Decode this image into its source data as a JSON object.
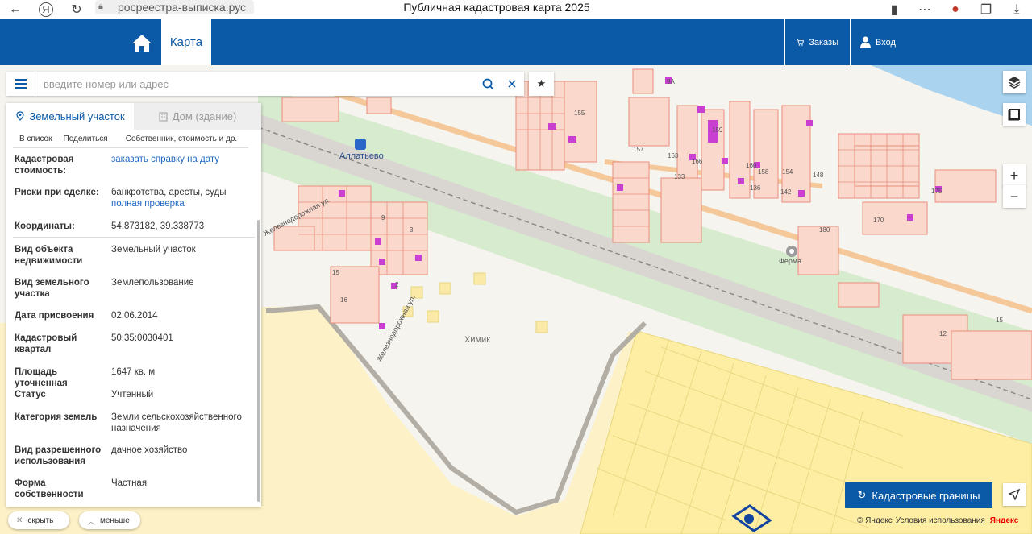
{
  "browser": {
    "url": "росреестра-выписка.рус",
    "title": "Публичная кадастровая карта 2025"
  },
  "header": {
    "tab_map": "Карта",
    "orders": "Заказы",
    "login": "Вход"
  },
  "search": {
    "placeholder": "введите номер или адрес"
  },
  "panel": {
    "tabs": [
      {
        "label": "Земельный участок"
      },
      {
        "label": "Дом (здание)"
      }
    ],
    "actions": {
      "to_list": "В список",
      "share": "Поделиться",
      "owner": "Собственник, стоимость и др."
    },
    "rows": [
      {
        "label": "Кадастровая стоимость:",
        "value": "заказать справку на дату"
      },
      {
        "label": "Риски при сделке:",
        "value": "банкротства, аресты, суды",
        "link": "полная проверка"
      },
      {
        "label": "Координаты:",
        "value": "54.873182, 39.338773"
      },
      {
        "label": "Вид объекта недвижимости",
        "value": "Земельный участок"
      },
      {
        "label": "Вид земельного участка",
        "value": "Землепользование"
      },
      {
        "label": "Дата присвоения",
        "value": "02.06.2014"
      },
      {
        "label": "Кадастровый квартал",
        "value": "50:35:0030401"
      },
      {
        "label": "Площадь уточненная",
        "value": "1647 кв. м"
      },
      {
        "label": "Статус",
        "value": "Учтенный"
      },
      {
        "label": "Категория земель",
        "value": "Земли сельскохозяйственного назначения"
      },
      {
        "label": "Вид разрешенного использования",
        "value": "дачное хозяйство"
      },
      {
        "label": "Форма собственности",
        "value": "Частная"
      }
    ]
  },
  "bottom": {
    "hide": "скрыть",
    "less": "меньше"
  },
  "map": {
    "labels": {
      "station": "Аллатьево",
      "village": "Химик",
      "farm": "Ферма",
      "street1": "Железнодорожная ул.",
      "street2": "Железнодорожная ул."
    },
    "numbers": [
      "155",
      "157",
      "163",
      "159",
      "166",
      "160",
      "158",
      "154",
      "148",
      "142",
      "136",
      "133",
      "170",
      "180",
      "175",
      "12",
      "15",
      "15",
      "16",
      "9",
      "3",
      "2",
      "2А",
      "9А"
    ]
  },
  "controls": {
    "zoom_in": "+",
    "zoom_out": "−",
    "cadastral_btn": "Кадастровые границы",
    "copyright": "© Яндекс",
    "terms": "Условия использования",
    "brand": "Яндекс"
  }
}
